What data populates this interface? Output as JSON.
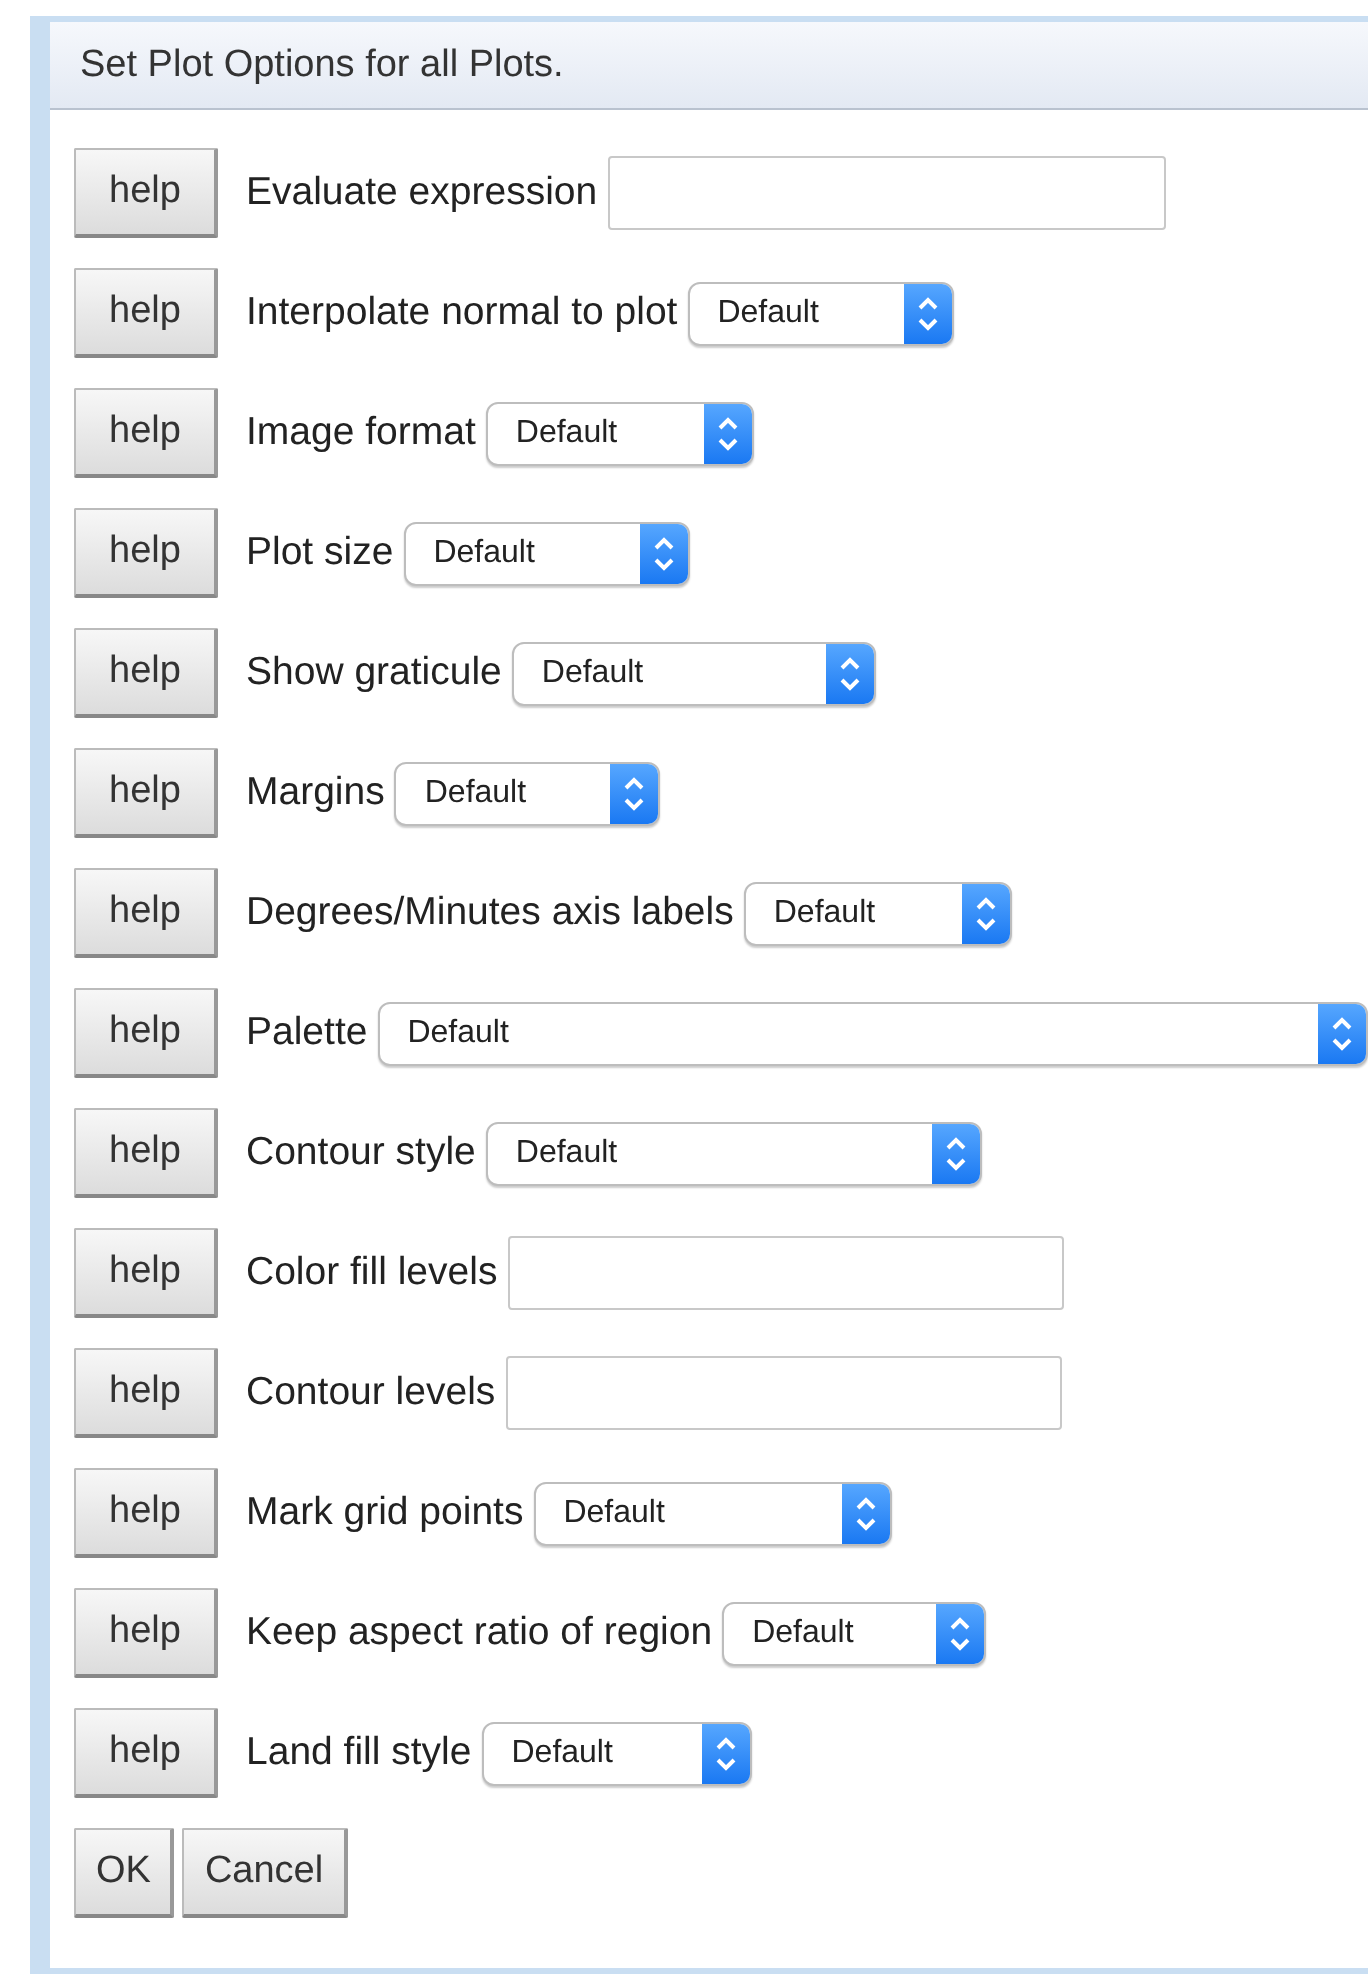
{
  "dialog": {
    "title": "Set Plot Options for all Plots."
  },
  "options": [
    {
      "kind": "text",
      "help": "help",
      "label": "Evaluate expression"
    },
    {
      "kind": "select",
      "help": "help",
      "label": "Interpolate normal to plot",
      "value": "Default"
    },
    {
      "kind": "select",
      "help": "help",
      "label": "Image format",
      "value": "Default"
    },
    {
      "kind": "select",
      "help": "help",
      "label": "Plot size",
      "value": "Default"
    },
    {
      "kind": "select",
      "help": "help",
      "label": "Show graticule",
      "value": "Default"
    },
    {
      "kind": "select",
      "help": "help",
      "label": "Margins",
      "value": "Default"
    },
    {
      "kind": "select",
      "help": "help",
      "label": "Degrees/Minutes axis labels",
      "value": "Default"
    },
    {
      "kind": "select",
      "help": "help",
      "label": "Palette",
      "value": "Default"
    },
    {
      "kind": "select",
      "help": "help",
      "label": "Contour style",
      "value": "Default"
    },
    {
      "kind": "text",
      "help": "help",
      "label": "Color fill levels"
    },
    {
      "kind": "text",
      "help": "help",
      "label": "Contour levels"
    },
    {
      "kind": "select",
      "help": "help",
      "label": "Mark grid points",
      "value": "Default"
    },
    {
      "kind": "select",
      "help": "help",
      "label": "Keep aspect ratio of region",
      "value": "Default"
    },
    {
      "kind": "select",
      "help": "help",
      "label": "Land fill style",
      "value": "Default"
    }
  ],
  "buttons": [
    "OK",
    "Cancel"
  ]
}
